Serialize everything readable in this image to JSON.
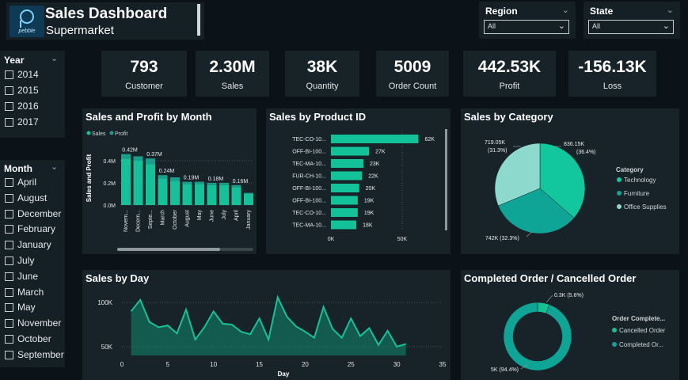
{
  "header": {
    "title": "Sales Dashboard",
    "subtitle": "Supermarket",
    "logo_text": "pebble"
  },
  "filters": {
    "region": {
      "label": "Region",
      "value": "All"
    },
    "state": {
      "label": "State",
      "value": "All"
    }
  },
  "year_slicer": {
    "label": "Year",
    "items": [
      "2014",
      "2015",
      "2016",
      "2017"
    ]
  },
  "month_slicer": {
    "label": "Month",
    "items": [
      "April",
      "August",
      "December",
      "February",
      "January",
      "July",
      "June",
      "March",
      "May",
      "November",
      "October",
      "September"
    ]
  },
  "kpis": [
    {
      "value": "793",
      "label": "Customer"
    },
    {
      "value": "2.30M",
      "label": "Sales"
    },
    {
      "value": "38K",
      "label": "Quantity"
    },
    {
      "value": "5009",
      "label": "Order Count"
    },
    {
      "value": "442.53K",
      "label": "Profit"
    },
    {
      "value": "-156.13K",
      "label": "Loss"
    }
  ],
  "panels": {
    "month": "Sales and Profit by Month",
    "product": "Sales by Product ID",
    "category": "Sales by Category",
    "day": "Sales by Day",
    "orders": "Completed Order / Cancelled Order"
  },
  "colors": {
    "sales": "#14c29a",
    "profit": "#1a9e8c",
    "teal_dark": "#0ea597",
    "teal_light": "#8ed9cd"
  },
  "chart_data": [
    {
      "type": "bar",
      "title": "Sales and Profit by Month",
      "ylabel": "Sales and Profit",
      "legend": [
        "Sales",
        "Profit"
      ],
      "categories": [
        "November",
        "December",
        "September",
        "March",
        "October",
        "August",
        "May",
        "June",
        "July",
        "April",
        "January"
      ],
      "category_labels": [
        "Novem...",
        "Decem...",
        "Septe...",
        "March",
        "October",
        "August",
        "May",
        "June",
        "July",
        "April",
        "January"
      ],
      "series": [
        {
          "name": "Sales",
          "values": [
            0.42,
            0.4,
            0.37,
            0.24,
            0.22,
            0.19,
            0.19,
            0.18,
            0.18,
            0.16,
            0.1
          ]
        },
        {
          "name": "Profit",
          "values": [
            0.04,
            0.04,
            0.05,
            0.03,
            0.03,
            0.02,
            0.02,
            0.02,
            0.02,
            0.02,
            0.01
          ]
        }
      ],
      "data_labels": [
        "0.42M",
        "",
        "0.37M",
        "0.24M",
        "",
        "0.19M",
        "",
        "0.18M",
        "",
        "0.16M",
        ""
      ],
      "y_ticks": [
        "0.0M",
        "0.2M",
        "0.4M"
      ],
      "ylim": [
        0,
        0.5
      ]
    },
    {
      "type": "bar",
      "orientation": "horizontal",
      "title": "Sales by Product ID",
      "categories": [
        "TEC-CO-10...",
        "OFF-BI-100...",
        "TEC-MA-10...",
        "FUR-CH-10...",
        "OFF-BI-100...",
        "OFF-BI-100...",
        "TEC-CO-10...",
        "TEC-MA-10..."
      ],
      "values": [
        62,
        27,
        23,
        22,
        20,
        19,
        19,
        18
      ],
      "value_labels": [
        "62K",
        "27K",
        "23K",
        "22K",
        "20K",
        "19K",
        "19K",
        "18K"
      ],
      "x_ticks": [
        "0K",
        "50K"
      ],
      "xlim": [
        0,
        80
      ]
    },
    {
      "type": "pie",
      "title": "Sales by Category",
      "legend_title": "Category",
      "labels": [
        "Technology",
        "Furniture",
        "Office Supplies"
      ],
      "values": [
        836.15,
        742,
        719.05
      ],
      "value_labels": [
        "836.15K (36.4%)",
        "742K (32.3%)",
        "719.05K (31.3%)"
      ],
      "colors": [
        "#12c69d",
        "#0ea597",
        "#8ed9cd"
      ]
    },
    {
      "type": "area",
      "title": "Sales by Day",
      "xlabel": "Day",
      "x_ticks": [
        0,
        5,
        10,
        15,
        20,
        25,
        30,
        35
      ],
      "y_ticks": [
        "50K",
        "100K"
      ],
      "xlim": [
        0,
        35
      ],
      "ylim": [
        40,
        110
      ],
      "x": [
        1,
        2,
        3,
        4,
        5,
        6,
        7,
        8,
        9,
        10,
        11,
        12,
        13,
        14,
        15,
        16,
        17,
        18,
        19,
        20,
        21,
        22,
        23,
        24,
        25,
        26,
        27,
        28,
        29,
        30,
        31
      ],
      "values": [
        90,
        103,
        78,
        72,
        74,
        65,
        92,
        58,
        72,
        90,
        76,
        75,
        67,
        64,
        82,
        58,
        106,
        84,
        73,
        67,
        60,
        95,
        70,
        60,
        82,
        62,
        71,
        52,
        68,
        50,
        53
      ]
    },
    {
      "type": "pie",
      "title": "Completed Order / Cancelled Order",
      "legend_title": "Order Complete...",
      "labels": [
        "Cancelled Order",
        "Completed Or..."
      ],
      "values": [
        0.3,
        5
      ],
      "value_labels": [
        "0.3K (5.6%)",
        "5K (94.4%)"
      ],
      "colors": [
        "#15c193",
        "#0ea597"
      ]
    }
  ]
}
